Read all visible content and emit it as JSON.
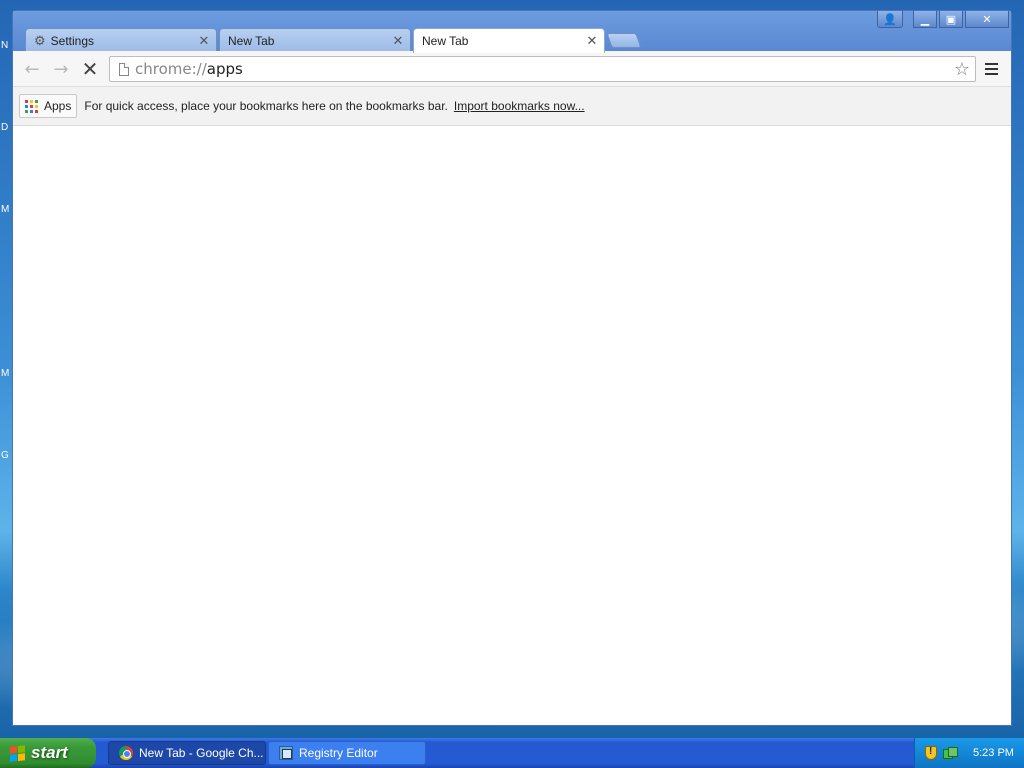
{
  "desktop": {
    "letters": [
      "N",
      "D",
      "M",
      "M",
      "G"
    ]
  },
  "tabs": [
    {
      "label": "Settings",
      "icon": "gear-icon",
      "active": false
    },
    {
      "label": "New Tab",
      "icon": null,
      "active": false
    },
    {
      "label": "New Tab",
      "icon": null,
      "active": true
    }
  ],
  "window_controls": {
    "user": "user-icon",
    "minimize": "minimize-icon",
    "maximize": "restore-icon",
    "close": "close-icon"
  },
  "toolbar": {
    "back_icon": "back-arrow-icon",
    "forward_icon": "forward-arrow-icon",
    "stop_icon": "stop-icon",
    "url_scheme": "chrome://",
    "url_host": "apps"
  },
  "bookmarks": {
    "apps_label": "Apps",
    "hint": "For quick access, place your bookmarks here on the bookmarks bar.",
    "import_link": "Import bookmarks now..."
  },
  "taskbar": {
    "start_label": "start",
    "items": [
      {
        "label": "New Tab - Google Ch...",
        "icon": "chrome-icon",
        "active": true
      },
      {
        "label": "Registry Editor",
        "icon": "regedit-icon",
        "active": false
      }
    ],
    "clock": "5:23 PM"
  },
  "colors": {
    "taskbar_blue": "#245ad2",
    "start_green": "#3a9a3a",
    "chrome_frame": "#6e9ce0"
  }
}
